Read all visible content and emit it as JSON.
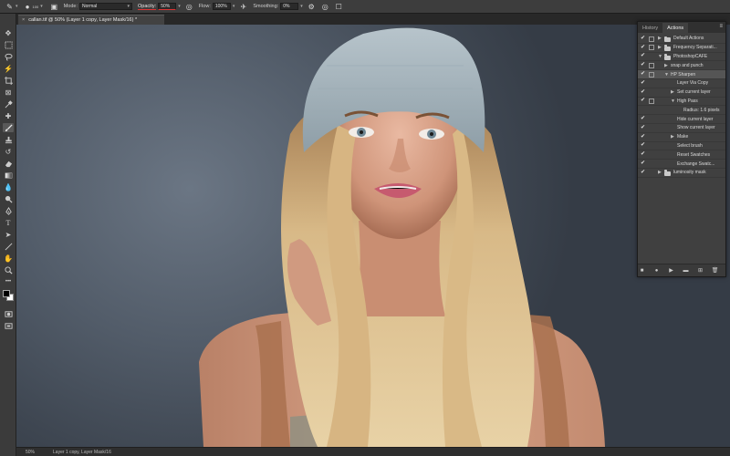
{
  "options_bar": {
    "brush_size": "100",
    "mode_label": "Mode:",
    "mode_value": "Normal",
    "opacity_label": "Opacity:",
    "opacity_value": "50%",
    "flow_label": "Flow:",
    "flow_value": "100%",
    "smoothing_label": "Smoothing:",
    "smoothing_value": "0%"
  },
  "document_tab": {
    "title": "callan.tif @ 50% (Layer 1 copy, Layer Mask/16) *"
  },
  "panel": {
    "tabs": [
      "History",
      "Actions"
    ],
    "active_tab": "Actions",
    "actions": [
      {
        "label": "Default Actions",
        "type": "set",
        "level": 0,
        "checked": true,
        "dialog": true,
        "expanded": false
      },
      {
        "label": "Frequency Separati...",
        "type": "set",
        "level": 0,
        "checked": true,
        "dialog": true,
        "expanded": false
      },
      {
        "label": "PhotoshopCAFE",
        "type": "set",
        "level": 0,
        "checked": true,
        "dialog": false,
        "expanded": true
      },
      {
        "label": "snap and punch",
        "type": "action",
        "level": 1,
        "checked": true,
        "dialog": true,
        "expanded": false
      },
      {
        "label": "HP Sharpen",
        "type": "action",
        "level": 1,
        "checked": true,
        "dialog": true,
        "expanded": true,
        "selected": true
      },
      {
        "label": "Layer Via Copy",
        "type": "step",
        "level": 2,
        "checked": true,
        "dialog": false,
        "expanded": null
      },
      {
        "label": "Set current layer",
        "type": "step",
        "level": 2,
        "checked": true,
        "dialog": false,
        "expanded": false
      },
      {
        "label": "High Pass",
        "type": "step",
        "level": 2,
        "checked": true,
        "dialog": true,
        "expanded": true
      },
      {
        "label": "Radius: 1.6 pixels",
        "type": "detail",
        "level": 3,
        "checked": false,
        "dialog": false,
        "expanded": null
      },
      {
        "label": "Hide current layer",
        "type": "step",
        "level": 2,
        "checked": true,
        "dialog": false,
        "expanded": null
      },
      {
        "label": "Show current layer",
        "type": "step",
        "level": 2,
        "checked": true,
        "dialog": false,
        "expanded": null
      },
      {
        "label": "Make",
        "type": "step",
        "level": 2,
        "checked": true,
        "dialog": false,
        "expanded": false
      },
      {
        "label": "Select brush",
        "type": "step",
        "level": 2,
        "checked": true,
        "dialog": false,
        "expanded": null
      },
      {
        "label": "Reset Swatches",
        "type": "step",
        "level": 2,
        "checked": true,
        "dialog": false,
        "expanded": null
      },
      {
        "label": "Exchange Swatc...",
        "type": "step",
        "level": 2,
        "checked": true,
        "dialog": false,
        "expanded": null
      },
      {
        "label": "luminosity mask",
        "type": "set",
        "level": 0,
        "checked": true,
        "dialog": false,
        "expanded": false
      }
    ]
  },
  "status_bar": {
    "zoom": "50%",
    "doc_info": "Layer 1 copy, Layer Mask/16"
  },
  "icons": {
    "check": "✔",
    "tri_right": "▶",
    "tri_down": "▼"
  },
  "colors": {
    "accent_underline": "#dd3333",
    "panel_bg": "#404040",
    "selected_row": "#555555"
  }
}
